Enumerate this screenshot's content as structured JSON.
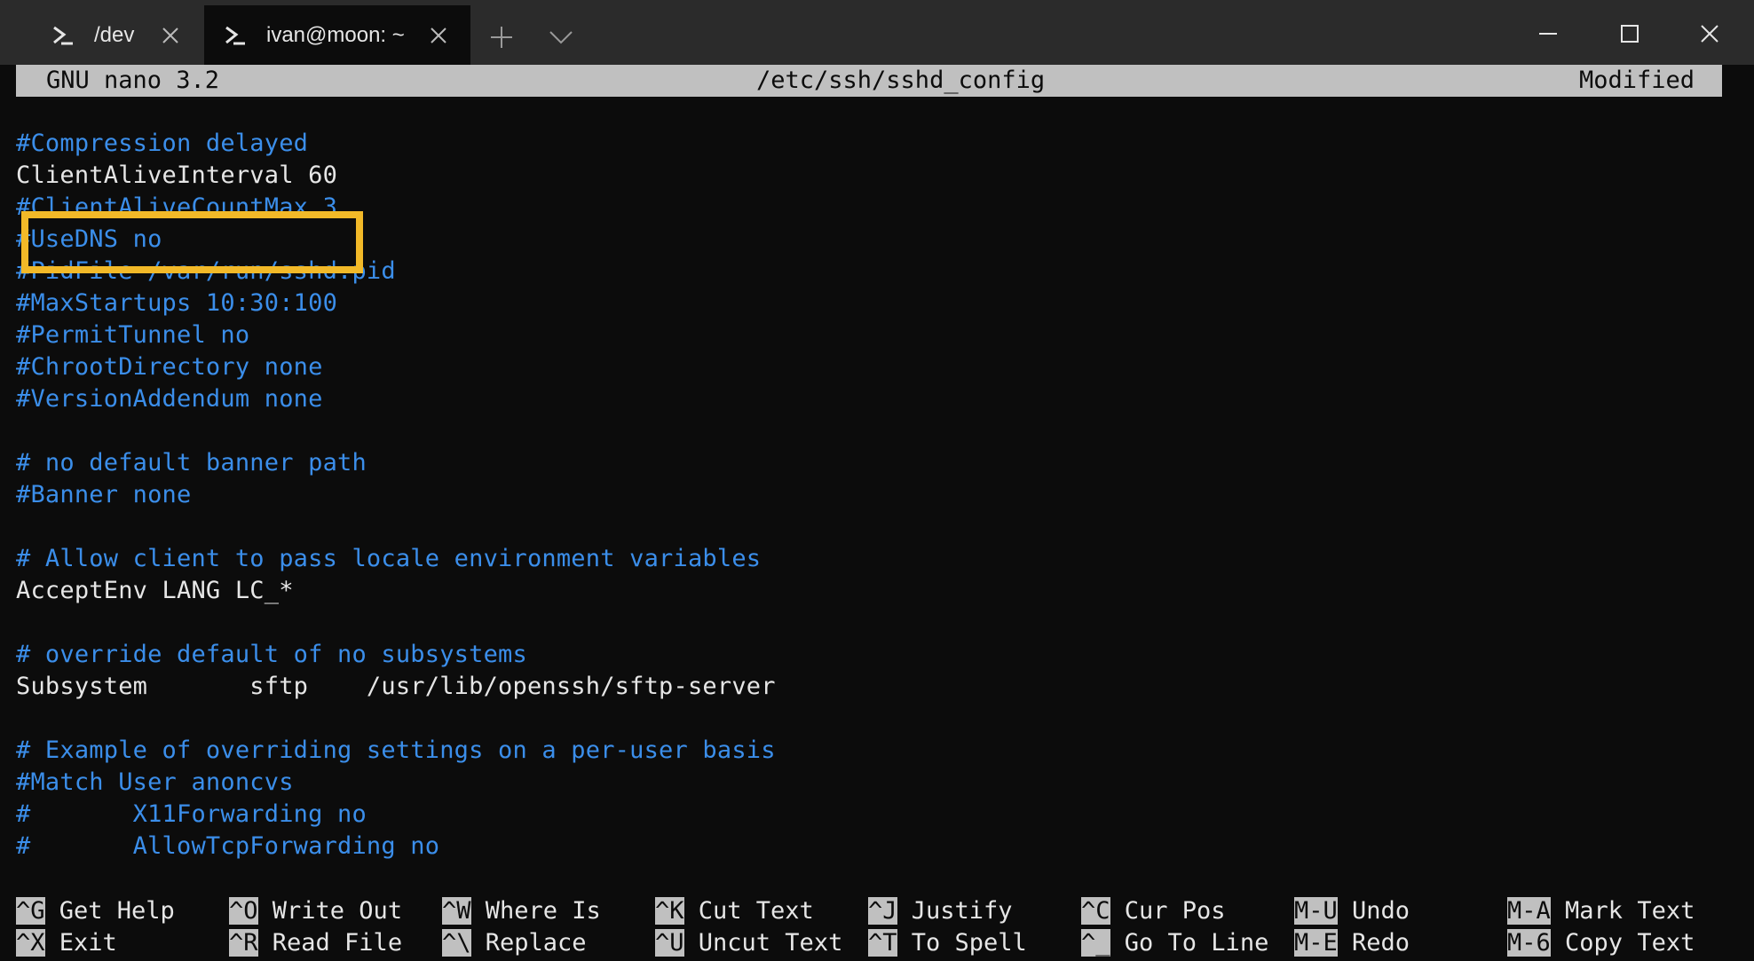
{
  "tabs": [
    {
      "label": "/dev",
      "active": false
    },
    {
      "label": "ivan@moon: ~",
      "active": true
    }
  ],
  "nano": {
    "version": "GNU nano 3.2",
    "filename": "/etc/ssh/sshd_config",
    "status": "Modified"
  },
  "lines": [
    {
      "text": "#Compression delayed",
      "style": "blue"
    },
    {
      "text": "ClientAliveInterval 60",
      "style": "white"
    },
    {
      "text": "#ClientAliveCountMax 3",
      "style": "blue"
    },
    {
      "text": "#UseDNS no",
      "style": "blue"
    },
    {
      "text": "#PidFile /var/run/sshd.pid",
      "style": "blue"
    },
    {
      "text": "#MaxStartups 10:30:100",
      "style": "blue"
    },
    {
      "text": "#PermitTunnel no",
      "style": "blue"
    },
    {
      "text": "#ChrootDirectory none",
      "style": "blue"
    },
    {
      "text": "#VersionAddendum none",
      "style": "blue"
    },
    {
      "text": "",
      "style": "white"
    },
    {
      "text": "# no default banner path",
      "style": "blue"
    },
    {
      "text": "#Banner none",
      "style": "blue"
    },
    {
      "text": "",
      "style": "white"
    },
    {
      "text": "# Allow client to pass locale environment variables",
      "style": "blue"
    },
    {
      "text": "AcceptEnv LANG LC_*",
      "style": "white"
    },
    {
      "text": "",
      "style": "white"
    },
    {
      "text": "# override default of no subsystems",
      "style": "blue"
    },
    {
      "text": "Subsystem       sftp    /usr/lib/openssh/sftp-server",
      "style": "white"
    },
    {
      "text": "",
      "style": "white"
    },
    {
      "text": "# Example of overriding settings on a per-user basis",
      "style": "blue"
    },
    {
      "text": "#Match User anoncvs",
      "style": "blue"
    },
    {
      "text": "#       X11Forwarding no",
      "style": "blue"
    },
    {
      "text": "#       AllowTcpForwarding no",
      "style": "blue"
    }
  ],
  "shortcuts_row1": [
    {
      "key": "^G",
      "label": "Get Help"
    },
    {
      "key": "^O",
      "label": "Write Out"
    },
    {
      "key": "^W",
      "label": "Where Is"
    },
    {
      "key": "^K",
      "label": "Cut Text"
    },
    {
      "key": "^J",
      "label": "Justify"
    },
    {
      "key": "^C",
      "label": "Cur Pos"
    },
    {
      "key": "M-U",
      "label": "Undo"
    },
    {
      "key": "M-A",
      "label": "Mark Text"
    }
  ],
  "shortcuts_row2": [
    {
      "key": "^X",
      "label": "Exit"
    },
    {
      "key": "^R",
      "label": "Read File"
    },
    {
      "key": "^\\",
      "label": "Replace"
    },
    {
      "key": "^U",
      "label": "Uncut Text"
    },
    {
      "key": "^T",
      "label": "To Spell"
    },
    {
      "key": "^_",
      "label": "Go To Line"
    },
    {
      "key": "M-E",
      "label": "Redo"
    },
    {
      "key": "M-6",
      "label": "Copy Text"
    }
  ],
  "colors": {
    "comment": "#3b8eea",
    "text": "#e6e6e6",
    "highlight": "#f2b928",
    "header_bg": "#c0c0c0"
  }
}
